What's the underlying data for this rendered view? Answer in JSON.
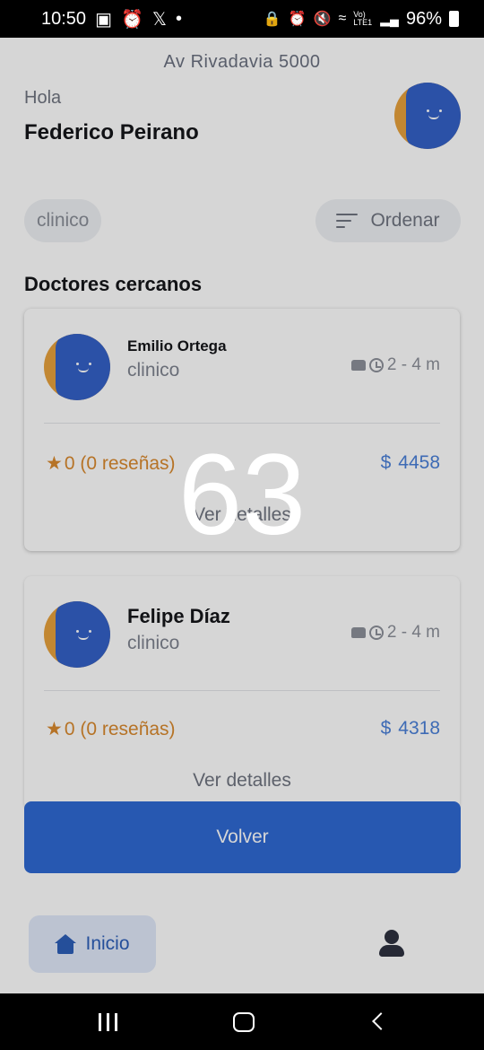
{
  "status_bar": {
    "time": "10:50",
    "signal_text": "Vo) LTE1",
    "battery": "96%"
  },
  "header": {
    "address": "Av Rivadavia 5000",
    "greeting": "Hola",
    "user_name": "Federico Peirano"
  },
  "filters": {
    "search_value": "clinico",
    "sort_label": "Ordenar"
  },
  "section": {
    "title": "Doctores cercanos"
  },
  "doctors": [
    {
      "name": "Emilio Ortega",
      "specialty": "clinico",
      "eta": "2 - 4 m",
      "rating": "0 (0 reseñas)",
      "price": "4458",
      "currency": "$",
      "details_label": "Ver detalles"
    },
    {
      "name": "Felipe Díaz",
      "specialty": "clinico",
      "eta": "2 - 4 m",
      "rating": "0 (0 reseñas)",
      "price": "4318",
      "currency": "$",
      "details_label": "Ver detalles"
    }
  ],
  "actions": {
    "back_button": "Volver"
  },
  "bottom_nav": {
    "home_label": "Inicio"
  },
  "overlay": {
    "counter": "63"
  },
  "colors": {
    "primary": "#2f69d3",
    "star": "#d9892e",
    "price": "#4a80d8"
  }
}
